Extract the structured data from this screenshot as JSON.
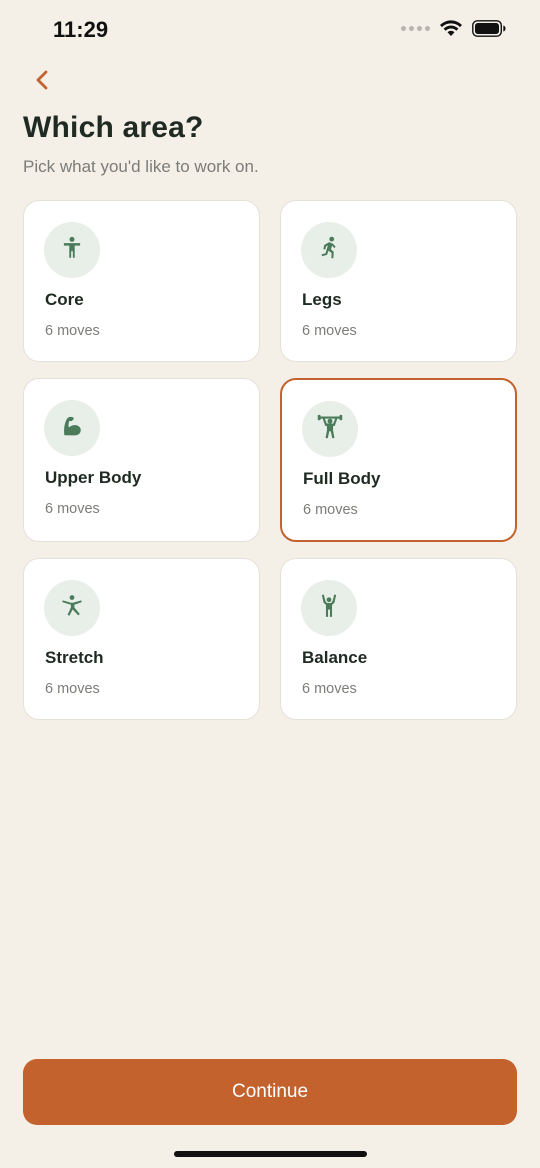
{
  "status_bar": {
    "time": "11:29"
  },
  "header": {
    "title": "Which area?",
    "subtitle": "Pick what you'd like to work on."
  },
  "areas": [
    {
      "label": "Core",
      "moves": "6 moves",
      "icon": "standing-person-icon",
      "selected": false
    },
    {
      "label": "Legs",
      "moves": "6 moves",
      "icon": "running-person-icon",
      "selected": false
    },
    {
      "label": "Upper Body",
      "moves": "6 moves",
      "icon": "flexed-arm-icon",
      "selected": false
    },
    {
      "label": "Full Body",
      "moves": "6 moves",
      "icon": "weightlifter-icon",
      "selected": true
    },
    {
      "label": "Stretch",
      "moves": "6 moves",
      "icon": "stretching-person-icon",
      "selected": false
    },
    {
      "label": "Balance",
      "moves": "6 moves",
      "icon": "arms-raised-person-icon",
      "selected": false
    }
  ],
  "footer": {
    "continue_label": "Continue"
  },
  "colors": {
    "accent": "#c4622d",
    "background": "#f4efe7",
    "icon_green": "#4a7c59",
    "icon_bg": "#e8eee8"
  }
}
